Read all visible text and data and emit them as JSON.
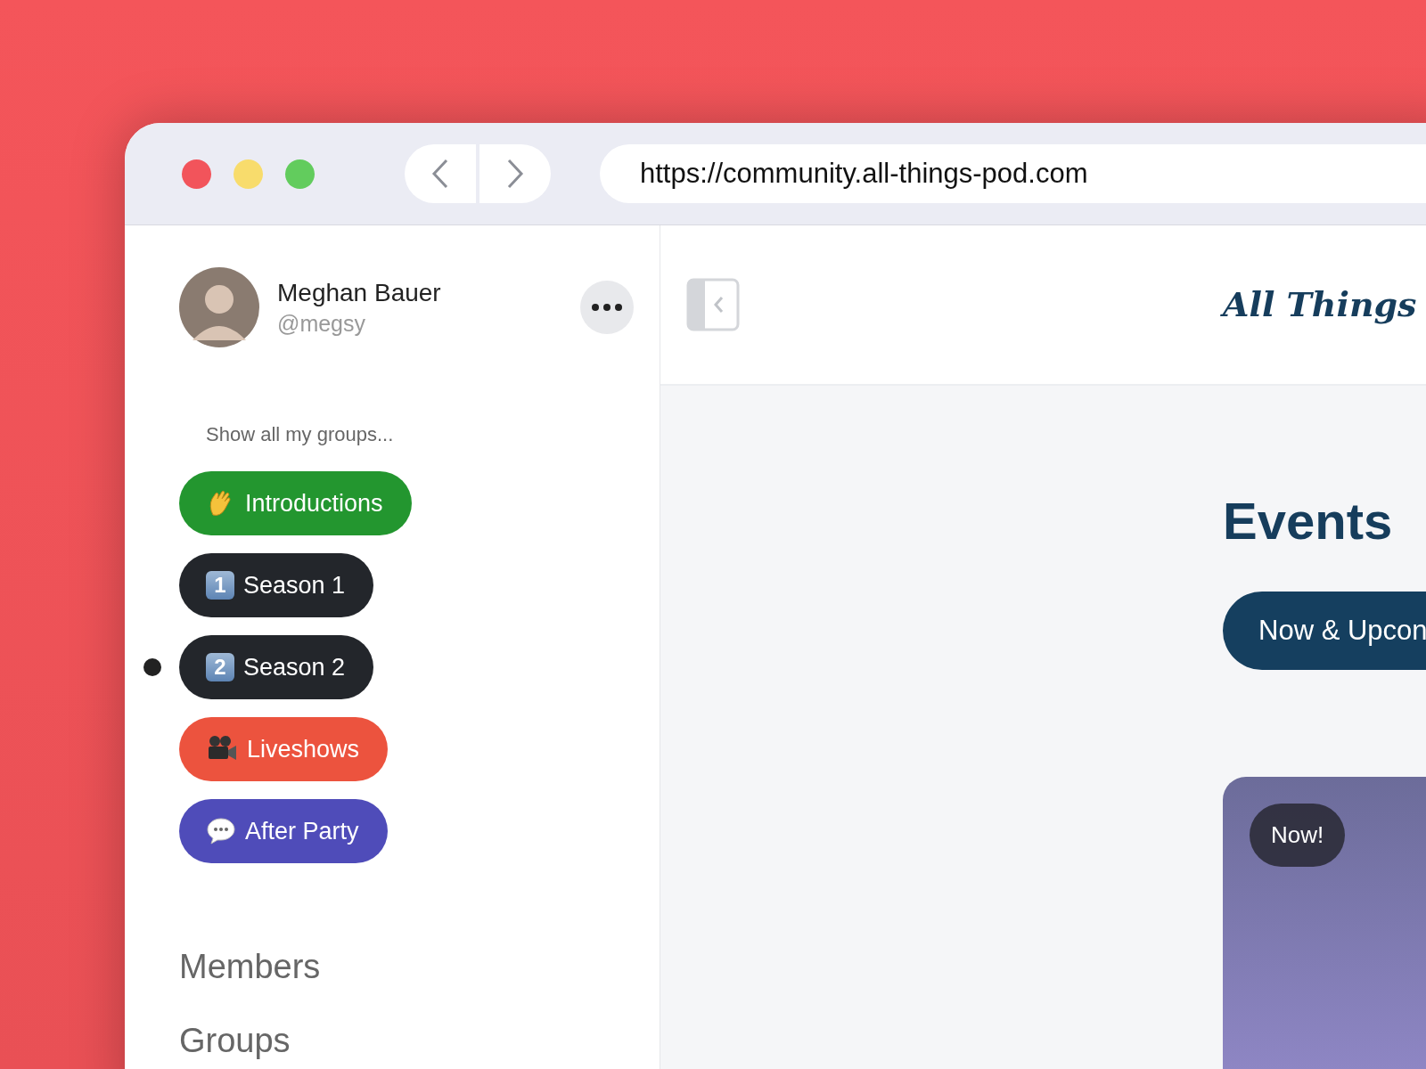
{
  "browser": {
    "url": "https://community.all-things-pod.com"
  },
  "profile": {
    "name": "Meghan Bauer",
    "handle": "@megsy"
  },
  "sidebar": {
    "show_all": "Show all my groups...",
    "groups": [
      {
        "label": "Introductions",
        "kind": "wave",
        "color": "#23962f",
        "selected": false
      },
      {
        "label": "Season 1",
        "kind": "keycap",
        "keycap": "1",
        "color": "#23262b",
        "selected": false
      },
      {
        "label": "Season 2",
        "kind": "keycap",
        "keycap": "2",
        "color": "#23262b",
        "selected": true
      },
      {
        "label": "Liveshows",
        "kind": "camera",
        "color": "#ec533e",
        "selected": false
      },
      {
        "label": "After Party",
        "kind": "speech",
        "color": "#4f4cb9",
        "selected": false
      }
    ],
    "sections": [
      "Members",
      "Groups"
    ]
  },
  "header": {
    "logo": "All Things"
  },
  "events": {
    "title": "Events",
    "tab": "Now & Upcon",
    "card": {
      "badge": "Now!"
    }
  }
}
